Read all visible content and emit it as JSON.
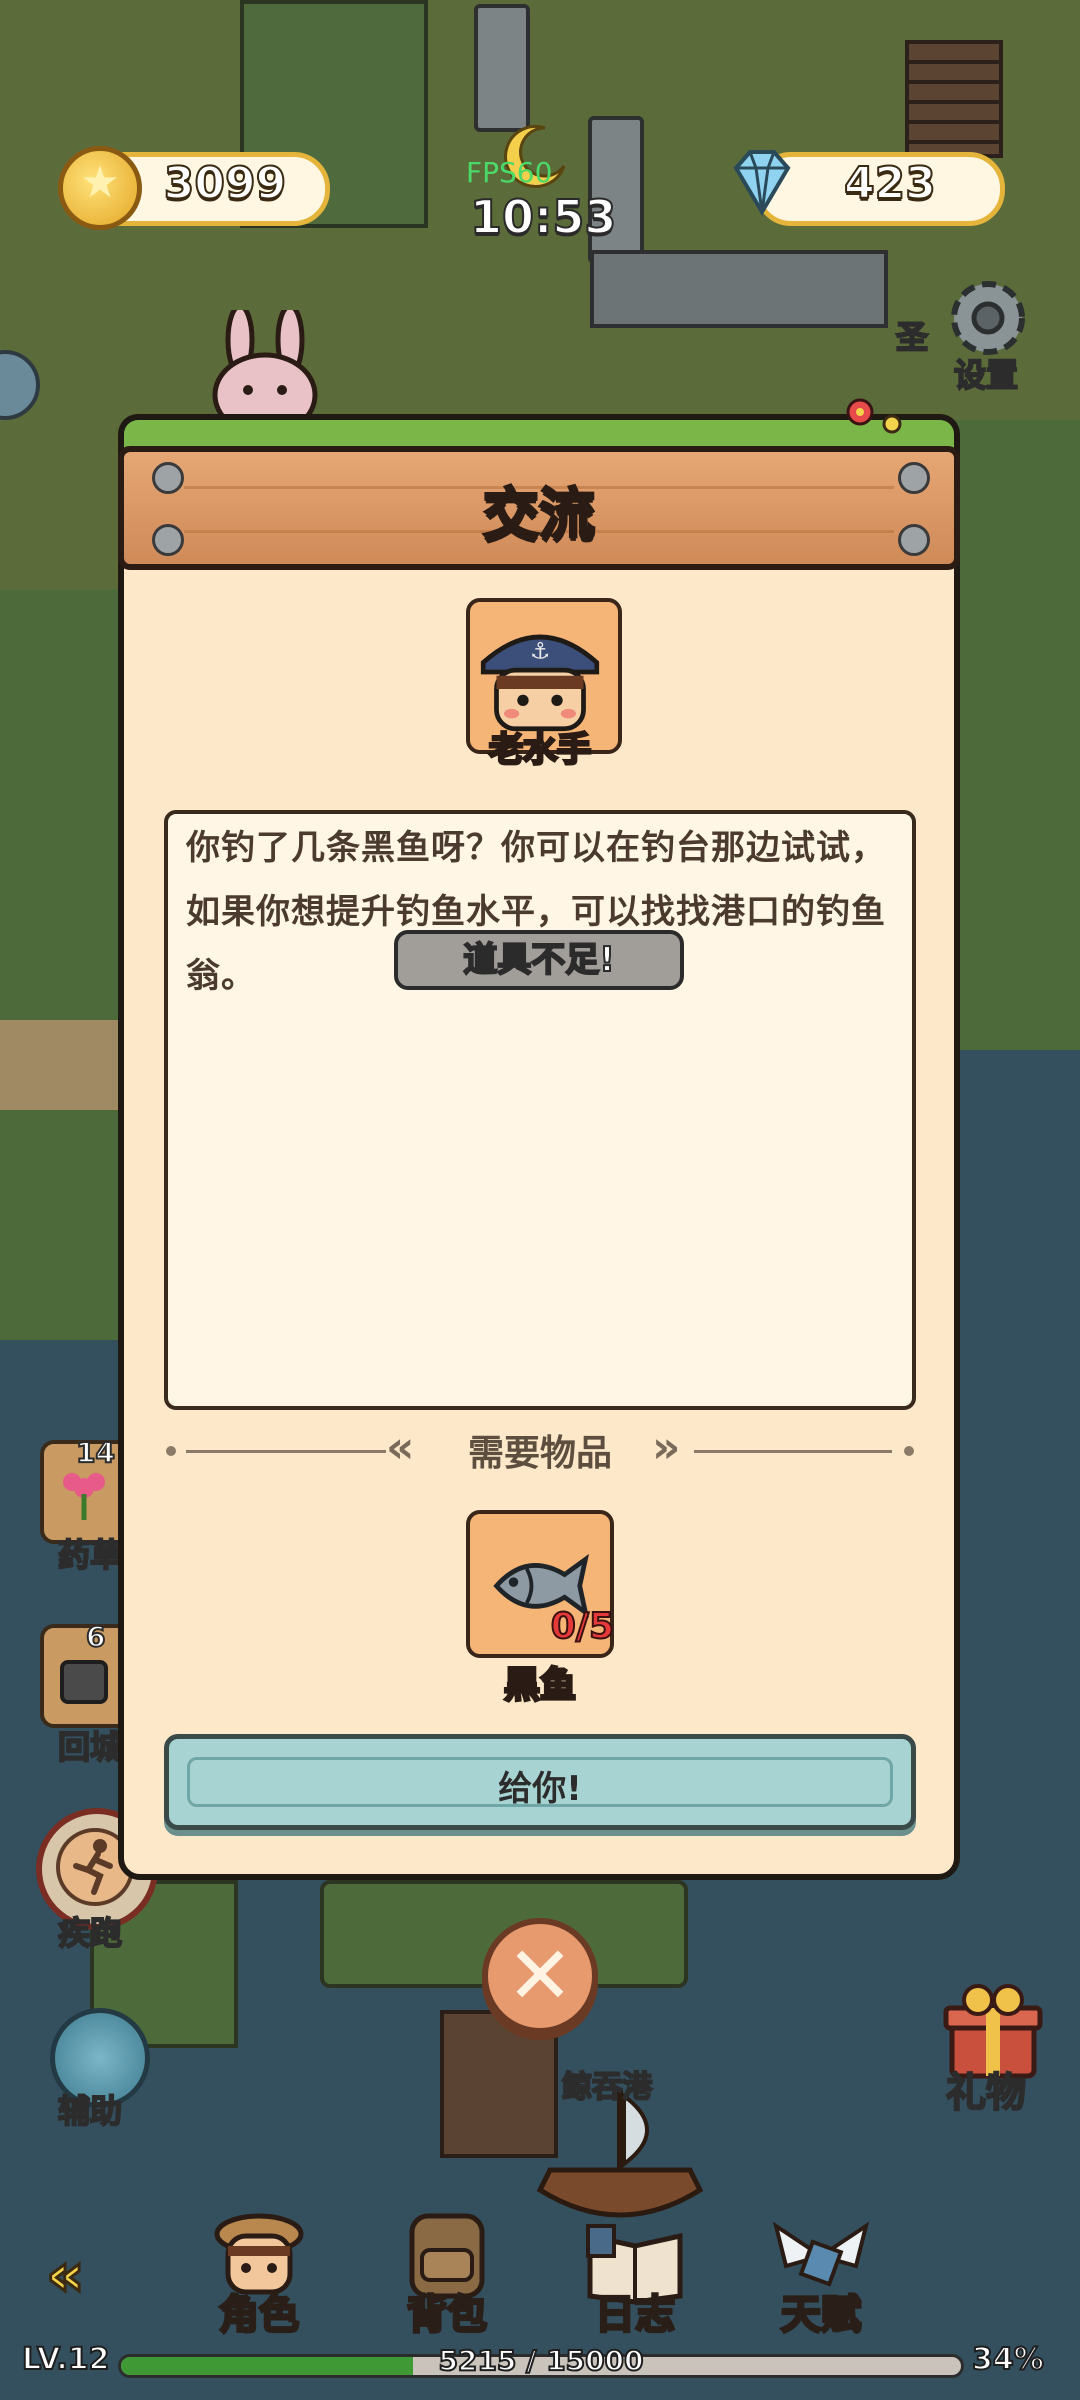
{
  "hud": {
    "coins": "3099",
    "gems": "423",
    "fps": "FPS60",
    "time": "10:53",
    "settings_label": "设置",
    "side_text": "圣"
  },
  "dialog": {
    "title": "交流",
    "npc_name": "老水手",
    "message": "你钓了几条黑鱼呀？你可以在钓台那边试试，如果你想提升钓鱼水平，可以找找港口的钓鱼翁。",
    "toast": "道具不足!",
    "required_header": "需要物品",
    "required_item": {
      "name": "黑鱼",
      "count": "0/5"
    },
    "give_button": "给你!"
  },
  "world": {
    "side_buttons": [
      {
        "count": "14",
        "label": "药草"
      },
      {
        "count": "6",
        "label": "回城"
      }
    ],
    "sprint_label": "疾跑",
    "assist_label": "辅助",
    "gift_label": "礼物",
    "location_label": "鲸吞港"
  },
  "nav": {
    "items": [
      {
        "label": "角色",
        "icon": "character-icon"
      },
      {
        "label": "背包",
        "icon": "backpack-icon"
      },
      {
        "label": "日志",
        "icon": "journal-icon"
      },
      {
        "label": "天赋",
        "icon": "talent-icon"
      }
    ]
  },
  "status": {
    "level": "LV.12",
    "xp_text": "5215 / 15000",
    "xp_fraction": 0.3477,
    "percent": "34%"
  },
  "colors": {
    "dialog_bg": "#fde9c9",
    "header_wood": "#d8925f",
    "give_button": "#a7d3d2",
    "xp_fill": "#3f9a36",
    "item_count": "#e63a3a"
  }
}
